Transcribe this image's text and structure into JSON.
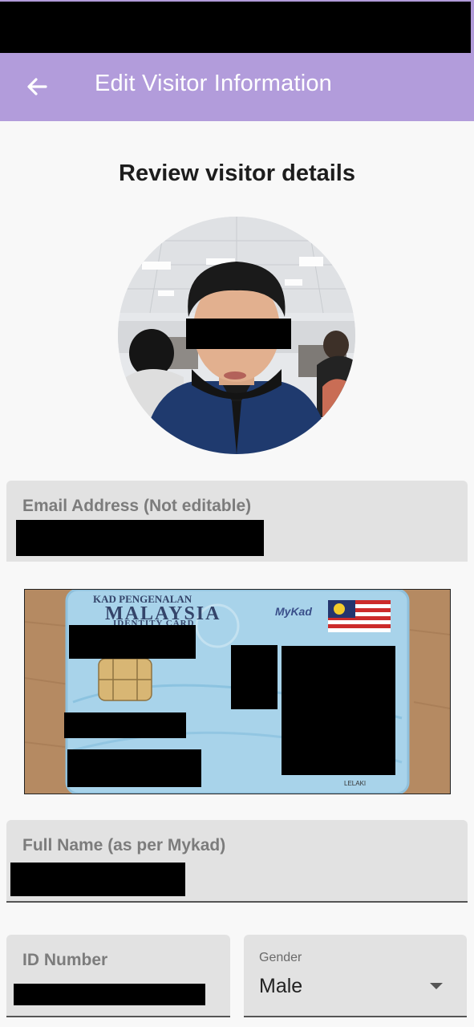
{
  "app_bar": {
    "title": "Edit Visitor Information",
    "back_icon": "arrow-left-icon",
    "color": "#b29cdb"
  },
  "page": {
    "heading": "Review visitor details"
  },
  "form": {
    "email": {
      "label": "Email Address (Not editable)"
    },
    "full_name": {
      "label": "Full Name (as per Mykad)"
    },
    "id_number": {
      "label": "ID Number"
    },
    "gender": {
      "label": "Gender",
      "value": "Male",
      "dropdown_icon": "caret-down-icon"
    }
  },
  "id_card": {
    "title_line1": "KAD PENGENALAN",
    "title_line2": "MALAYSIA",
    "title_line3": "IDENTITY CARD",
    "brand": "MyKad",
    "gender_text": "LELAKI"
  }
}
